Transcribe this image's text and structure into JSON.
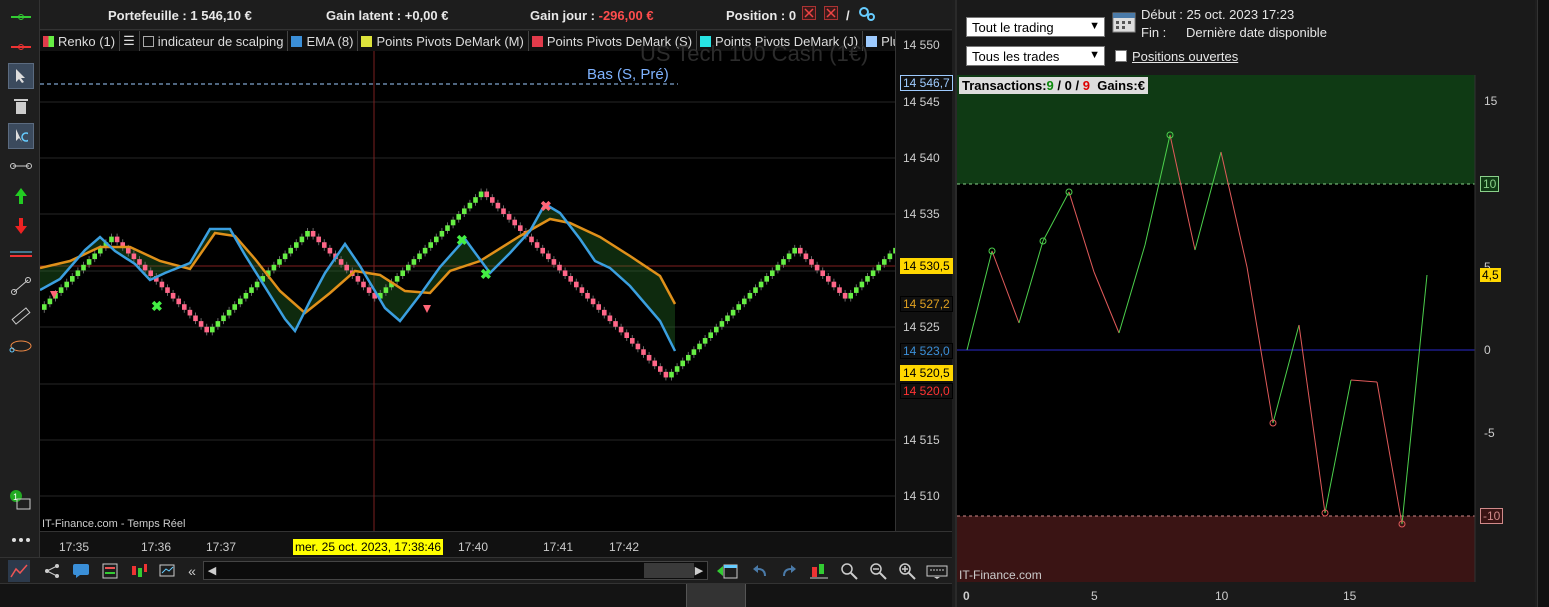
{
  "infobar": {
    "portefeuille_label": "Portefeuille :",
    "portefeuille_value": "1 546,10 €",
    "gain_latent_label": "Gain latent :",
    "gain_latent_value": "+0,00 €",
    "gain_jour_label": "Gain jour :",
    "gain_jour_value": "-296,00 €",
    "position_label": "Position :",
    "position_value": "0",
    "separator": "/"
  },
  "legend": [
    {
      "label": "Renko (1)",
      "color": "#e23b4b"
    },
    {
      "label": "indicateur de scalping",
      "color": "#1b1b1b"
    },
    {
      "label": "EMA (8)",
      "color": "#3b8fd8"
    },
    {
      "label": "Points Pivots DeMark (M)",
      "color": "#dde33b"
    },
    {
      "label": "Points Pivots DeMark (S)",
      "color": "#e23b4b"
    },
    {
      "label": "Points Pivots DeMark (J)",
      "color": "#27e3e3"
    },
    {
      "label": "Plu",
      "color": "#9ecbff"
    }
  ],
  "chart": {
    "watermark": "US Tech 100 Cash (1€)",
    "pivot_label": "Bas (S, Pré)",
    "source": "IT-Finance.com - Temps Réel",
    "price_ticks": [
      "14 550",
      "14 545",
      "14 540",
      "14 535",
      "14 525",
      "14 515",
      "14 510"
    ],
    "price_tags": [
      {
        "text": "14 546,7",
        "color": "#9ecbff",
        "bg": "#101010",
        "border": "#9ecbff"
      },
      {
        "text": "14 530,5",
        "color": "#000",
        "bg": "#ffd700",
        "border": "#ffd700"
      },
      {
        "text": "14 527,2",
        "color": "#e0a020",
        "bg": "#101010",
        "border": "#000"
      },
      {
        "text": "14 523,0",
        "color": "#3b8fd8",
        "bg": "#101010",
        "border": "#000"
      },
      {
        "text": "14 520,5",
        "color": "#000",
        "bg": "#ffd700",
        "border": "#ffd700"
      },
      {
        "text": "14 520,0",
        "color": "#ff3333",
        "bg": "#101010",
        "border": "#000"
      }
    ],
    "time_ticks": [
      "17:35",
      "17:36",
      "17:37",
      "17:40",
      "17:41",
      "17:42"
    ],
    "cursor_time": "mer. 25 oct. 2023, 17:38:46",
    "colors": {
      "up": "#66ee44",
      "down": "#ff6688",
      "ema_fast": "#3b9fe0",
      "ema_slow": "#e0901a"
    }
  },
  "right": {
    "filter1": "Tout le trading",
    "filter2": "Tous les trades",
    "debut_label": "Début :",
    "debut_value": "25 oct. 2023 17:23",
    "fin_label": "Fin :",
    "fin_value": "Dernière date disponible",
    "positions_label": "Positions ouvertes",
    "transactions_label": "Transactions:",
    "tx_win": "9",
    "tx_sep1": "/",
    "tx_mid": "0",
    "tx_sep2": "/",
    "tx_loss": "9",
    "gains_label": "Gains:",
    "gains_value": "€",
    "source": "IT-Finance.com",
    "y_ticks": [
      "15",
      "10",
      "5",
      "0",
      "-5",
      "-10"
    ],
    "x_ticks": [
      "0",
      "5",
      "10",
      "15"
    ],
    "value_tag": "4,5"
  }
}
